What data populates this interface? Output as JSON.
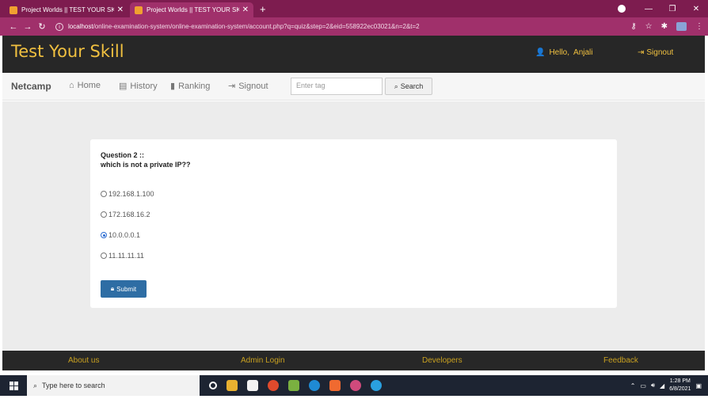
{
  "browser": {
    "tabs": [
      {
        "title": "Project Worlds || TEST YOUR SKIL",
        "active": false
      },
      {
        "title": "Project Worlds || TEST YOUR SKIL",
        "active": true
      }
    ],
    "new_tab": "+",
    "url_host": "localhost",
    "url_path": "/online-examination-system/online-examination-system/account.php?q=quiz&step=2&eid=558922ec03021&n=2&t=2"
  },
  "header": {
    "brand": "Test Your Skill",
    "greeting": "Hello,",
    "user": "Anjali",
    "signout": "Signout"
  },
  "navbar": {
    "brand": "Netcamp",
    "items": [
      {
        "label": "Home",
        "icon": "home-icon"
      },
      {
        "label": "History",
        "icon": "history-icon"
      },
      {
        "label": "Ranking",
        "icon": "ranking-icon"
      },
      {
        "label": "Signout",
        "icon": "signout-icon"
      }
    ],
    "search_placeholder": "Enter tag",
    "search_button": "Search"
  },
  "quiz": {
    "question_number": "Question  2 ::",
    "question_text": "which is not a private IP??",
    "options": [
      {
        "label": "192.168.1.100",
        "selected": false
      },
      {
        "label": "172.168.16.2",
        "selected": false
      },
      {
        "label": "10.0.0.0.1",
        "selected": true
      },
      {
        "label": "11.11.11.11",
        "selected": false
      }
    ],
    "submit": "Submit"
  },
  "footer": {
    "links": [
      "About us",
      "Admin Login",
      "Developers",
      "Feedback"
    ]
  },
  "taskbar": {
    "search_placeholder": "Type here to search",
    "time": "1:28 PM",
    "date": "6/8/2021"
  },
  "colors": {
    "tab_bar": "#7d1c4f",
    "address_bar": "#a0306b",
    "header": "#272727",
    "brand": "#f0c040",
    "submit": "#2e6da4"
  }
}
